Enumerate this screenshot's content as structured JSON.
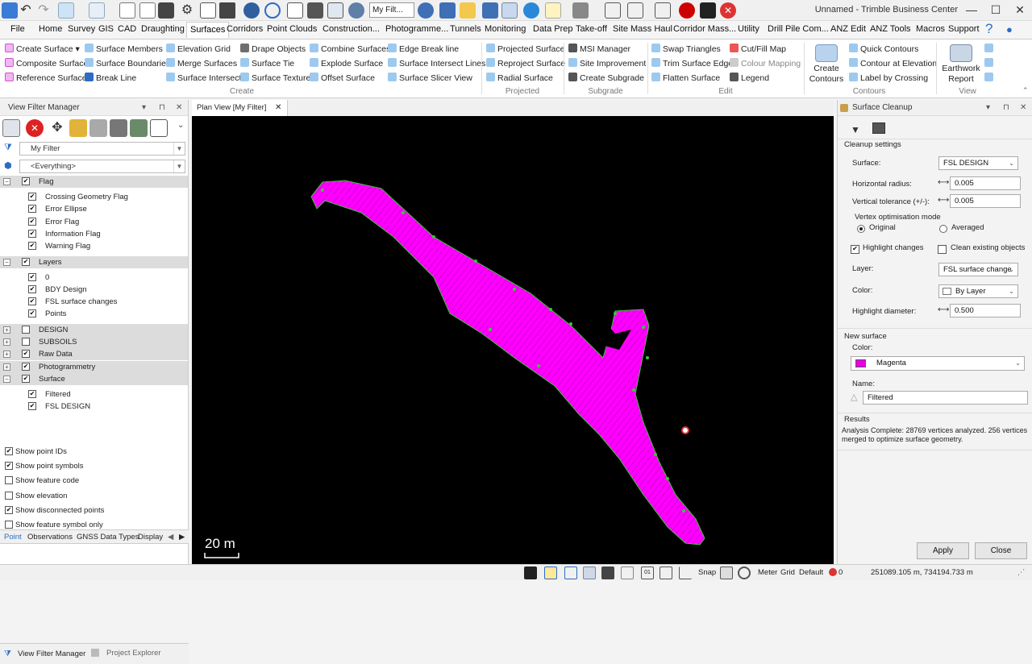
{
  "app": {
    "title": "Unnamed - Trimble Business Center",
    "filter_combo": "My Filt..."
  },
  "window_controls": [
    "—",
    "☐",
    "✕"
  ],
  "menus": [
    "File",
    "Home",
    "Survey",
    "GIS",
    "CAD",
    "Draughting",
    "Surfaces",
    "Corridors",
    "Point Clouds",
    "Construction...",
    "Photogramme...",
    "Tunnels",
    "Monitoring",
    "Data Prep",
    "Take-off",
    "Site Mass Haul",
    "Corridor Mass...",
    "Utility",
    "Drill Pile Com...",
    "ANZ Edit",
    "ANZ Tools",
    "Macros",
    "Support"
  ],
  "active_menu": "Surfaces",
  "ribbon": {
    "create": {
      "items": [
        "Create Surface",
        "Composite Surface",
        "Reference Surface",
        "Surface Members",
        "Surface Boundaries",
        "Break Line",
        "Elevation Grid",
        "Merge Surfaces",
        "Surface Intersect",
        "Drape Objects",
        "Surface Tie",
        "Surface Texture",
        "Combine Surfaces",
        "Explode Surface",
        "Offset Surface",
        "Edge Break line",
        "Surface Intersect Lines",
        "Surface Slicer View"
      ],
      "label": "Create"
    },
    "projected": {
      "items": [
        "Projected Surface",
        "Reproject Surface",
        "Radial Surface"
      ],
      "label": "Projected"
    },
    "subgrade": {
      "items": [
        "MSI Manager",
        "Site Improvement",
        "Create Subgrade"
      ],
      "label": "Subgrade"
    },
    "edit": {
      "items": [
        "Swap Triangles",
        "Trim Surface Edge",
        "Flatten Surface",
        "Cut/Fill Map",
        "Colour Mapping",
        "Legend"
      ],
      "label": "Edit"
    },
    "contours": {
      "big": "Create Contours",
      "items": [
        "Quick Contours",
        "Contour at Elevation",
        "Label by Crossing"
      ],
      "label": "Contours"
    },
    "view": {
      "big": "Earthwork Report",
      "label": "View"
    }
  },
  "left_panel": {
    "title": "View Filter Manager",
    "filter": "My Filter",
    "scope": "<Everything>",
    "tree": [
      {
        "label": "Flag",
        "group": true,
        "expanded": true,
        "checked": true,
        "children": [
          {
            "label": "Crossing Geometry Flag",
            "checked": true
          },
          {
            "label": "Error Ellipse",
            "checked": true
          },
          {
            "label": "Error Flag",
            "checked": true
          },
          {
            "label": "Information Flag",
            "checked": true
          },
          {
            "label": "Warning Flag",
            "checked": true
          }
        ]
      },
      {
        "label": "Layers",
        "group": true,
        "expanded": true,
        "checked": true,
        "children": [
          {
            "label": "0",
            "checked": true
          },
          {
            "label": "BDY Design",
            "checked": true
          },
          {
            "label": "FSL surface changes",
            "checked": true
          },
          {
            "label": "Points",
            "checked": true
          }
        ]
      },
      {
        "label": "DESIGN",
        "group": true,
        "expanded": false,
        "checked": false
      },
      {
        "label": "SUBSOILS",
        "group": true,
        "expanded": false,
        "checked": false
      },
      {
        "label": "Raw Data",
        "group": true,
        "expanded": false,
        "checked": true
      },
      {
        "label": "Photogrammetry",
        "group": true,
        "expanded": false,
        "checked": true
      },
      {
        "label": "Surface",
        "group": true,
        "expanded": true,
        "checked": true,
        "children": [
          {
            "label": "Filtered",
            "checked": true
          },
          {
            "label": "FSL DESIGN",
            "checked": true
          }
        ]
      }
    ],
    "tabs": [
      "Point",
      "Observations",
      "GNSS Data Types",
      "Display Or"
    ],
    "options": [
      {
        "label": "Show point IDs",
        "checked": true
      },
      {
        "label": "Show point symbols",
        "checked": true
      },
      {
        "label": "Show feature code",
        "checked": false
      },
      {
        "label": "Show elevation",
        "checked": false
      },
      {
        "label": "Show disconnected points",
        "checked": true
      },
      {
        "label": "Show feature symbol only",
        "checked": false
      }
    ],
    "bottom_tabs": [
      "View Filter Manager",
      "Project Explorer"
    ]
  },
  "plan": {
    "tab": "Plan View [My Filter]",
    "scale": "20 m"
  },
  "cleanup": {
    "title": "Surface Cleanup",
    "settings_heading": "Cleanup settings",
    "surface_label": "Surface:",
    "surface": "FSL DESIGN",
    "hradius_label": "Horizontal radius:",
    "hradius": "0.005",
    "vtol_label": "Vertical tolerance (+/-):",
    "vtol": "0.005",
    "vopt_label": "Vertex optimisation mode",
    "opt_original": "Original",
    "opt_averaged": "Averaged",
    "highlight_label": "Highlight changes",
    "highlight": true,
    "clean_label": "Clean existing objects",
    "clean": false,
    "layer_label": "Layer:",
    "layer": "FSL surface change",
    "color_label": "Color:",
    "color": "By Layer",
    "diam_label": "Highlight diameter:",
    "diam": "0.500",
    "new_heading": "New surface",
    "new_color_label": "Color:",
    "new_color": "Magenta",
    "new_color_hex": "#e600e6",
    "name_label": "Name:",
    "name": "Filtered",
    "results_heading": "Results",
    "results": "Analysis Complete: 28769 vertices analyzed. 256 vertices merged to optimize surface geometry.",
    "apply": "Apply",
    "close": "Close"
  },
  "status": {
    "snap": "Snap",
    "meter": "Meter",
    "grid": "Grid",
    "default": "Default",
    "count": "0",
    "coords": "251089.105 m, 734194.733 m"
  },
  "colors": {
    "surface": "#ff00ff",
    "edges": "#33cc33",
    "canvas": "#000000",
    "accent": "#2b6cc4"
  }
}
